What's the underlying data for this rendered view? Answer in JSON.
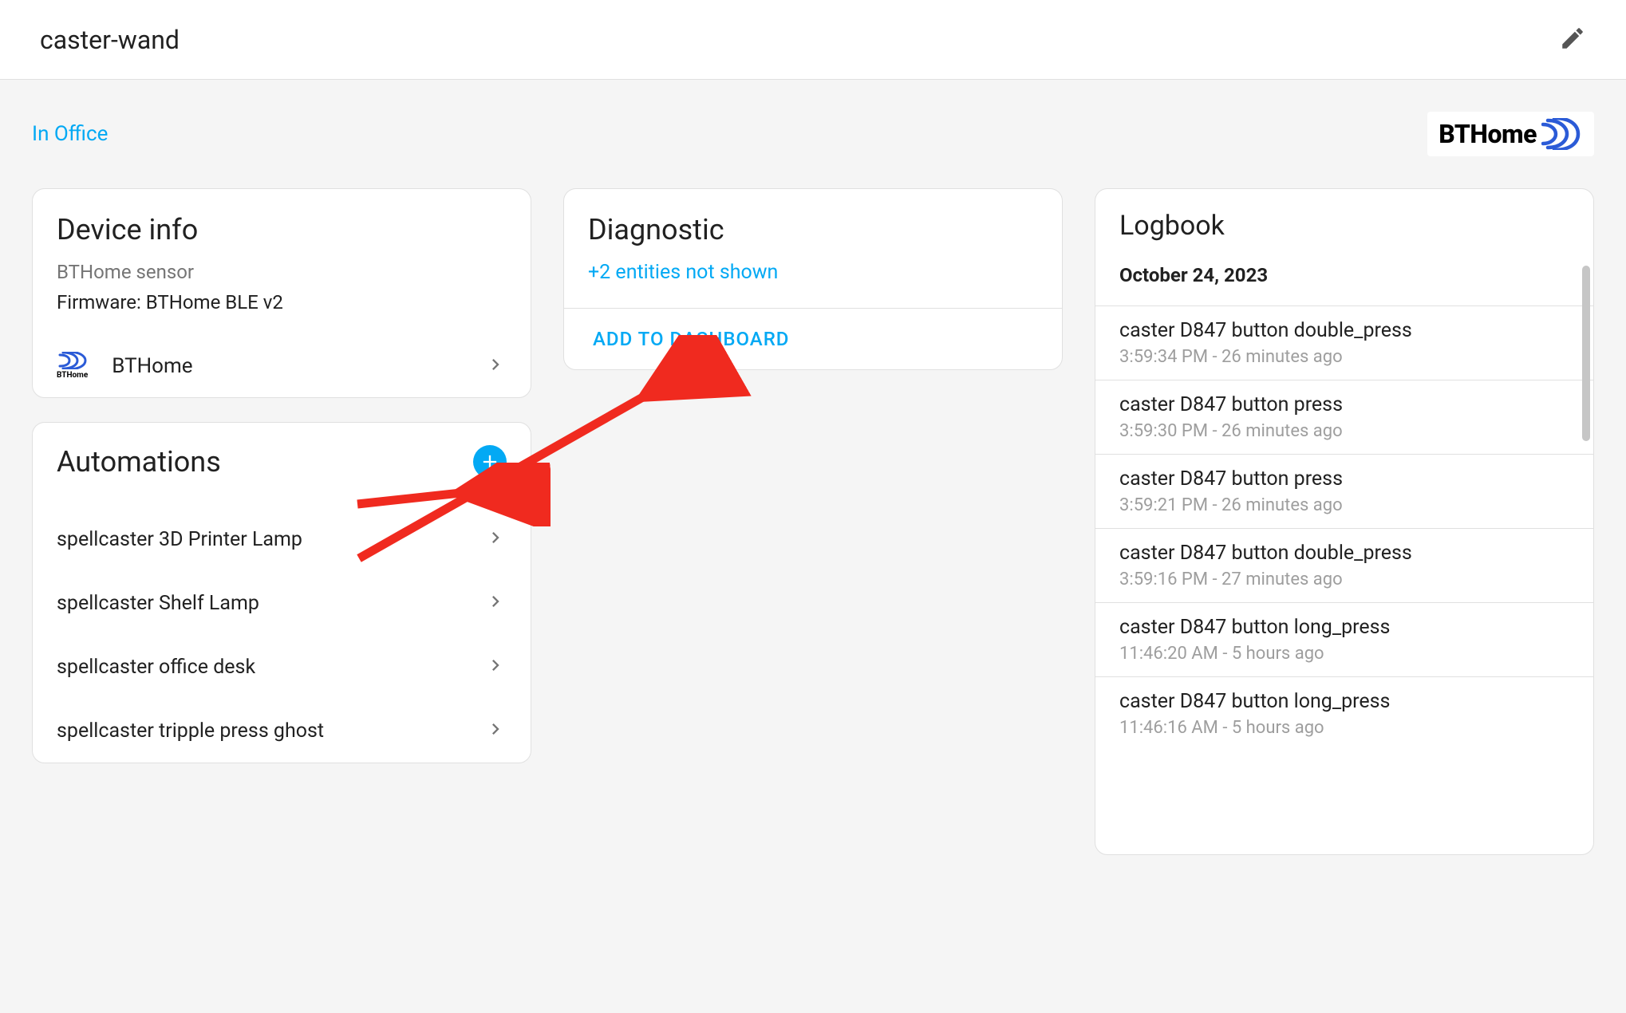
{
  "header": {
    "title": "caster-wand"
  },
  "area": {
    "name": "In Office"
  },
  "integration_logo": "BTHome",
  "device_info": {
    "card_title": "Device info",
    "type": "BTHome sensor",
    "firmware": "Firmware: BTHome BLE v2",
    "integration_label": "BTHome",
    "integration_icon_label": "BTHome"
  },
  "diagnostic": {
    "card_title": "Diagnostic",
    "hidden_entities": "+2 entities not shown",
    "add_to_dashboard": "ADD TO DASHBOARD"
  },
  "automations": {
    "card_title": "Automations",
    "items": [
      {
        "label": "spellcaster 3D Printer Lamp"
      },
      {
        "label": "spellcaster Shelf Lamp"
      },
      {
        "label": "spellcaster office desk"
      },
      {
        "label": "spellcaster tripple press ghost"
      }
    ]
  },
  "logbook": {
    "card_title": "Logbook",
    "date": "October 24, 2023",
    "entries": [
      {
        "title": "caster D847 button double_press",
        "time": "3:59:34 PM - 26 minutes ago"
      },
      {
        "title": "caster D847 button press",
        "time": "3:59:30 PM - 26 minutes ago"
      },
      {
        "title": "caster D847 button press",
        "time": "3:59:21 PM - 26 minutes ago"
      },
      {
        "title": "caster D847 button double_press",
        "time": "3:59:16 PM - 27 minutes ago"
      },
      {
        "title": "caster D847 button long_press",
        "time": "11:46:20 AM - 5 hours ago"
      },
      {
        "title": "caster D847 button long_press",
        "time": "11:46:16 AM - 5 hours ago"
      }
    ]
  },
  "annotations": {
    "color": "#f02a1f"
  }
}
